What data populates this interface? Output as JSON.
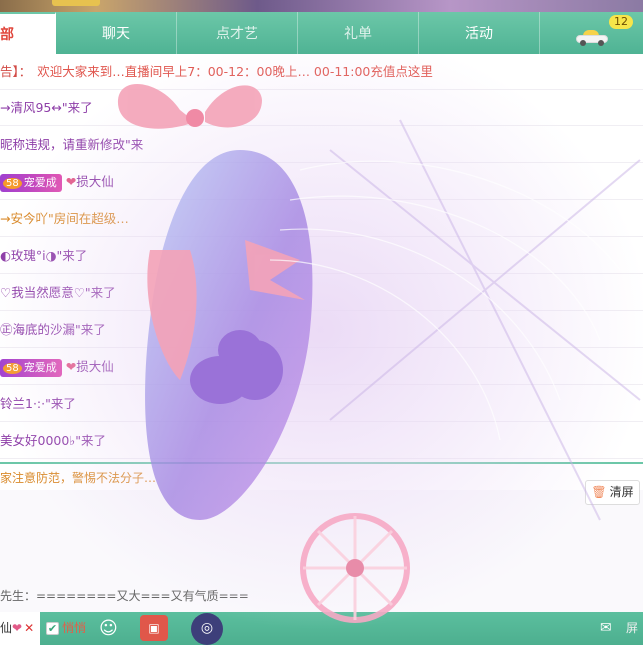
{
  "tabs": [
    {
      "label": "部",
      "active": true
    },
    {
      "label": "聊天"
    },
    {
      "label": "点才艺"
    },
    {
      "label": "礼单"
    },
    {
      "label": "活动"
    },
    {
      "label": "",
      "icon": "car-icon",
      "badge": "12"
    }
  ],
  "notice": {
    "label": "告】：",
    "text": "欢迎大家来到…直播间早上7：00-12：00晚上… 00-11:00充值点这里"
  },
  "messages": [
    {
      "text": "→清风95↔\"来了",
      "color": "purple"
    },
    {
      "text": "昵称违规，请重新修改\"来",
      "color": "purple"
    },
    {
      "level": "58",
      "levelText": "宠爱成",
      "user": "损大仙",
      "extra": "",
      "color": "purple"
    },
    {
      "text": "→安今吖\"房间在超级…",
      "color": "orange"
    },
    {
      "text": "◐玫瑰°i◑\"来了",
      "color": "purple"
    },
    {
      "text": "♡我当然愿意♡\"来了",
      "color": "purple"
    },
    {
      "text": "㊣海底的沙漏\"来了",
      "color": "purple"
    },
    {
      "level": "58",
      "levelText": "宠爱成",
      "user": "损大仙",
      "extra": "",
      "color": "purple"
    },
    {
      "text": "铃兰1·:·\"来了",
      "color": "purple"
    },
    {
      "text": "美女好0000♭\"来了",
      "color": "purple"
    }
  ],
  "warning": "家注意防范，警惕不法分子…",
  "clear_button": "清屏",
  "sample_text": "先生：========又大===又有气质===",
  "bottom": {
    "who_name": "仙",
    "checkbox_label": "悄悄",
    "msg_label": "屏"
  },
  "colors": {
    "accent": "#5bbf9e",
    "notice": "#e0564e",
    "username": "#8e3fa8",
    "warning": "#d98a2a"
  }
}
